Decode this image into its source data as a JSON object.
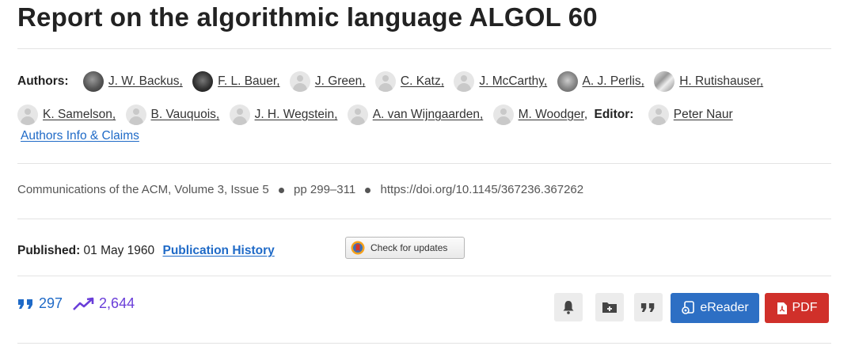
{
  "title": "Report on the algorithmic language ALGOL 60",
  "authors_label": "Authors:",
  "editor_label": "Editor:",
  "authors": [
    {
      "name": "J. W. Backus,",
      "avatar": "photo"
    },
    {
      "name": "F. L. Bauer,",
      "avatar": "photo"
    },
    {
      "name": "J. Green,",
      "avatar": "placeholder"
    },
    {
      "name": "C. Katz,",
      "avatar": "placeholder"
    },
    {
      "name": "J. McCarthy,",
      "avatar": "placeholder"
    },
    {
      "name": "A. J. Perlis,",
      "avatar": "photo"
    },
    {
      "name": "H. Rutishauser,",
      "avatar": "photo"
    },
    {
      "name": "K. Samelson,",
      "avatar": "placeholder"
    },
    {
      "name": "B. Vauquois,",
      "avatar": "placeholder"
    },
    {
      "name": "J. H. Wegstein,",
      "avatar": "placeholder"
    },
    {
      "name": "A. van Wijngaarden,",
      "avatar": "placeholder"
    },
    {
      "name": "M. Woodger",
      "avatar": "placeholder"
    }
  ],
  "editor": {
    "name": "Peter Naur",
    "avatar": "placeholder"
  },
  "authors_info_link": "Authors Info & Claims",
  "citation": {
    "journal": "Communications of the ACM",
    "sep1": ",",
    "volume": "Volume 3",
    "sep2": ",",
    "issue": "Issue 5",
    "pages": "pp 299–311",
    "doi": "https://doi.org/10.1145/367236.367262"
  },
  "published": {
    "label": "Published:",
    "date": "01 May 1960",
    "history_link": "Publication History"
  },
  "check_updates_label": "Check for updates",
  "metrics": {
    "citations": "297",
    "downloads": "2,644"
  },
  "buttons": {
    "ereader": "eReader",
    "pdf": "PDF"
  },
  "colors": {
    "link_blue": "#1f6ac7",
    "downloads_purple": "#6a3ed9",
    "ereader_bg": "#2d6fc4",
    "pdf_bg": "#d0302a"
  },
  "icons": [
    "quote-icon",
    "trending-up-icon",
    "bell-icon",
    "folder-add-icon",
    "cite-icon",
    "ereader-icon",
    "pdf-file-icon",
    "check-updates-icon"
  ]
}
